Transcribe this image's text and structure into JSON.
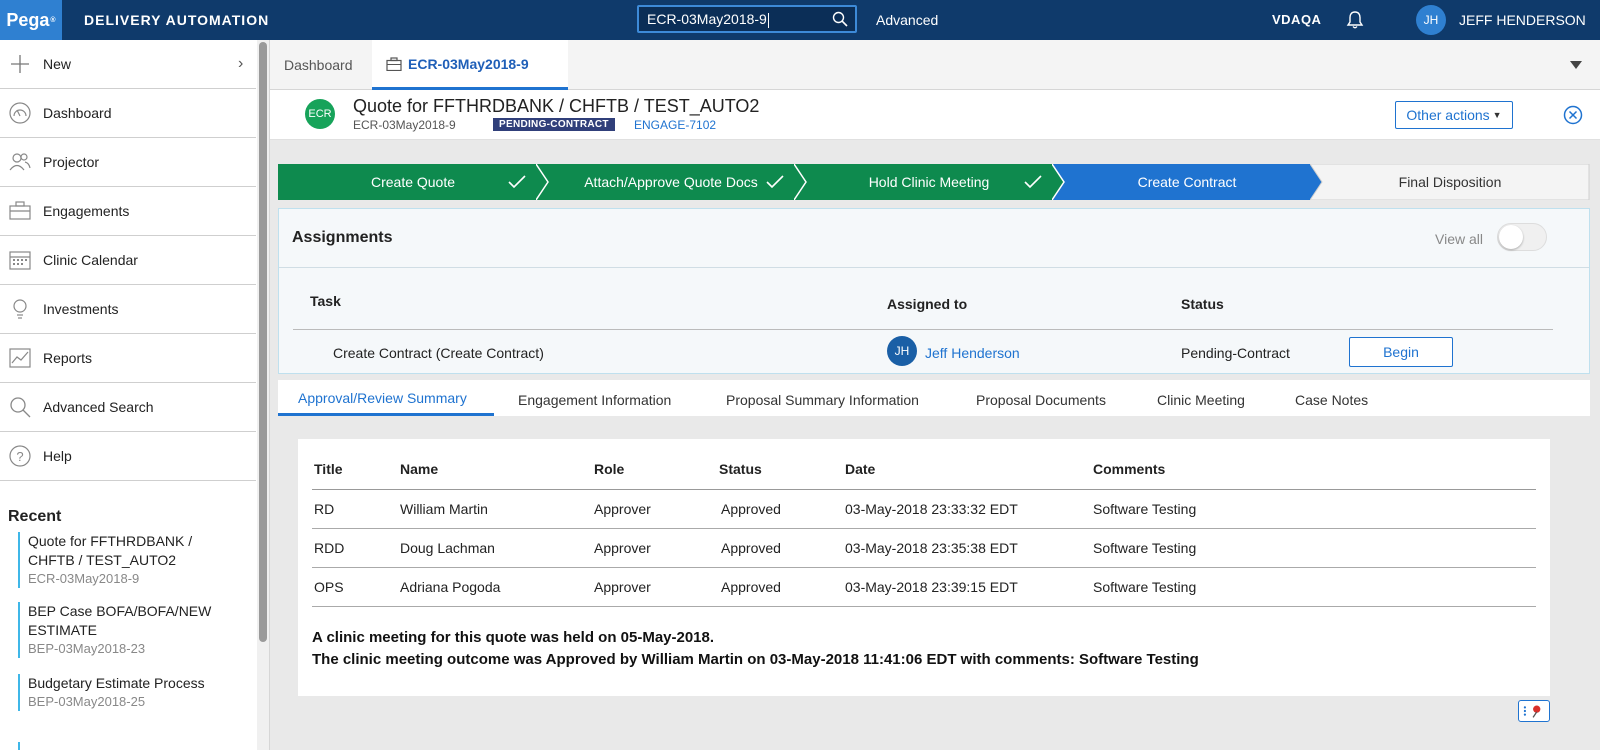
{
  "topbar": {
    "logo": "Pega",
    "logo_mark": "®",
    "app_title": "DELIVERY AUTOMATION",
    "search_value": "ECR-03May2018-9",
    "advanced_label": "Advanced",
    "environment": "VDAQA",
    "user_initials": "JH",
    "user_name": "JEFF HENDERSON",
    "colors": {
      "bar": "#0f3a6b",
      "logo": "#2f80d1"
    }
  },
  "sidebar": {
    "items": [
      {
        "label": "New",
        "icon": "plus-icon"
      },
      {
        "label": "Dashboard",
        "icon": "dashboard-icon"
      },
      {
        "label": "Projector",
        "icon": "users-icon"
      },
      {
        "label": "Engagements",
        "icon": "briefcase-icon"
      },
      {
        "label": "Clinic Calendar",
        "icon": "calendar-icon"
      },
      {
        "label": "Investments",
        "icon": "lightbulb-icon"
      },
      {
        "label": "Reports",
        "icon": "chart-icon"
      },
      {
        "label": "Advanced Search",
        "icon": "search-icon"
      },
      {
        "label": "Help",
        "icon": "help-icon"
      }
    ],
    "recent_title": "Recent",
    "recent": [
      {
        "title": "Quote for FFTHRDBANK / CHFTB / TEST_AUTO2",
        "id": "ECR-03May2018-9"
      },
      {
        "title": "BEP Case BOFA/BOFA/NEW ESTIMATE",
        "id": "BEP-03May2018-23"
      },
      {
        "title": "Budgetary Estimate Process",
        "id": "BEP-03May2018-25"
      }
    ]
  },
  "tabs": [
    {
      "label": "Dashboard",
      "active": false
    },
    {
      "label": "ECR-03May2018-9",
      "active": true
    }
  ],
  "case": {
    "badge": "ECR",
    "title": "Quote for FFTHRDBANK / CHFTB / TEST_AUTO2",
    "id": "ECR-03May2018-9",
    "status": "PENDING-CONTRACT",
    "engagement": "ENGAGE-7102",
    "other_actions": "Other actions"
  },
  "stages": [
    {
      "label": "Create Quote",
      "state": "complete"
    },
    {
      "label": "Attach/Approve Quote Docs",
      "state": "complete"
    },
    {
      "label": "Hold Clinic Meeting",
      "state": "complete"
    },
    {
      "label": "Create Contract",
      "state": "current"
    },
    {
      "label": "Final Disposition",
      "state": "future"
    }
  ],
  "stage_colors": {
    "complete": "#0e8a4e",
    "current": "#1f73d0",
    "future": "#f4f4f4"
  },
  "assignments": {
    "title": "Assignments",
    "view_all": "View all",
    "headers": {
      "task": "Task",
      "assigned_to": "Assigned to",
      "status": "Status"
    },
    "rows": [
      {
        "task": "Create Contract (Create Contract)",
        "assignee_initials": "JH",
        "assignee": "Jeff Henderson",
        "status": "Pending-Contract",
        "action": "Begin"
      }
    ]
  },
  "subtabs": [
    {
      "label": "Approval/Review Summary",
      "active": true
    },
    {
      "label": "Engagement Information",
      "active": false
    },
    {
      "label": "Proposal Summary Information",
      "active": false
    },
    {
      "label": "Proposal Documents",
      "active": false
    },
    {
      "label": "Clinic Meeting",
      "active": false
    },
    {
      "label": "Case Notes",
      "active": false
    }
  ],
  "approvals": {
    "headers": {
      "title": "Title",
      "name": "Name",
      "role": "Role",
      "status": "Status",
      "date": "Date",
      "comments": "Comments"
    },
    "rows": [
      {
        "title": "RD",
        "name": "William Martin",
        "role": "Approver",
        "status": "Approved",
        "date": "03-May-2018 23:33:32 EDT",
        "comments": "Software Testing"
      },
      {
        "title": "RDD",
        "name": "Doug Lachman",
        "role": "Approver",
        "status": "Approved",
        "date": "03-May-2018 23:35:38 EDT",
        "comments": "Software Testing"
      },
      {
        "title": "OPS",
        "name": "Adriana Pogoda",
        "role": "Approver",
        "status": "Approved",
        "date": "03-May-2018 23:39:15 EDT",
        "comments": "Software Testing"
      }
    ],
    "clinic_line_1": "A clinic meeting for this quote was held on 05-May-2018.",
    "clinic_line_2": "The clinic meeting outcome was Approved by William Martin on 03-May-2018 11:41:06 EDT with comments: Software Testing"
  }
}
